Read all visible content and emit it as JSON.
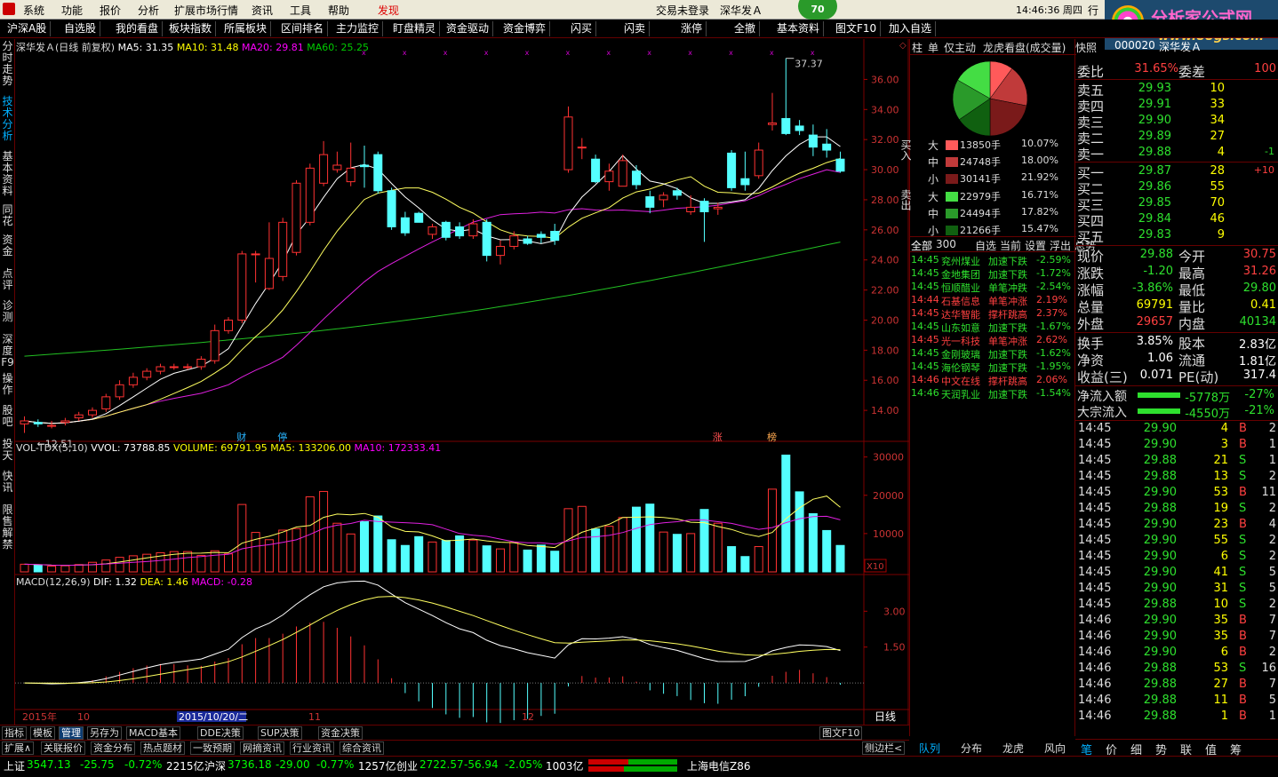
{
  "menu": {
    "items": [
      "系统",
      "功能",
      "报价",
      "分析",
      "扩展市场行情",
      "资讯",
      "工具",
      "帮助",
      "发现"
    ],
    "login": "交易未登录",
    "stock_title": "深华发Ａ",
    "badge": "70",
    "time": "14:46:36 周四",
    "trade": "行"
  },
  "logo": {
    "line1": "分析家公式网",
    "line2": "www.88gs.com"
  },
  "toolbar": [
    "沪深A股",
    "自选股",
    "我的看盘",
    "板块指数",
    "所属板块",
    "区间排名",
    "主力监控",
    "盯盘精灵",
    "资金驱动",
    "资金博弈",
    "闪买",
    "闪卖",
    "涨停",
    "全撤",
    "基本资料",
    "图文F10",
    "加入自选"
  ],
  "left_tabs": [
    "分时走势",
    "技术分析",
    "基本资料",
    "同花",
    "资金",
    "点评",
    "诊测",
    "深度F9",
    "操作",
    "股吧",
    "投天",
    "快讯",
    "限售解禁"
  ],
  "chart": {
    "title": "深华发Ａ(日线 前复权)",
    "ma5": "MA5: 31.35",
    "ma10": "MA10: 31.48",
    "ma20": "MA20: 29.81",
    "ma60": "MA60: 25.25",
    "high_label": "37.37",
    "low_label": "←12.51",
    "price_ticks": [
      "36.00",
      "34.00",
      "32.00",
      "30.00",
      "28.00",
      "26.00",
      "24.00",
      "22.00",
      "20.00",
      "18.00",
      "16.00",
      "14.00"
    ],
    "event_markers": [
      "财",
      "停",
      "涨",
      "榜"
    ],
    "vol_title": "VOL-TDX(5,10)",
    "vvol": "VVOL: 73788.85",
    "volume": "VOLUME: 69791.95",
    "vma5": "MA5: 133206.00",
    "vma10": "MA10: 172333.41",
    "vol_ticks": [
      "30000",
      "20000",
      "10000"
    ],
    "vol_unit": "X10",
    "macd_title": "MACD(12,26,9)",
    "dif": "DIF: 1.32",
    "dea": "DEA: 1.46",
    "macd": "MACD: -0.28",
    "macd_ticks": [
      "3.00",
      "1.50"
    ],
    "dates": [
      "2015年",
      "10",
      "2015/10/20/二",
      "11",
      "12"
    ],
    "period": "日线",
    "zoom_ctrl": [
      "+",
      "-",
      "0"
    ]
  },
  "chart_data": {
    "type": "candlestick",
    "open": [
      13.1,
      13.2,
      13.0,
      13.2,
      13.5,
      13.7,
      14.1,
      14.9,
      15.7,
      16.2,
      16.6,
      16.9,
      16.9,
      16.9,
      17.3,
      19.3,
      20.0,
      24.4,
      22.1,
      22.9,
      24.5,
      26.5,
      29.1,
      30.0,
      29.2,
      30.3,
      31.0,
      28.6,
      26.8,
      27.1,
      25.7,
      26.5,
      26.2,
      25.6,
      26.5,
      24.3,
      24.9,
      25.4,
      25.7,
      25.9,
      30.0,
      31.5,
      30.7,
      29.2,
      28.9,
      29.9,
      28.2,
      28.0,
      28.6,
      27.2,
      27.9,
      27.4,
      31.1,
      29.4,
      29.6,
      33.0,
      33.4,
      32.9,
      32.3,
      31.7,
      30.7
    ],
    "close": [
      13.3,
      13.1,
      13.0,
      13.3,
      13.7,
      14.0,
      14.9,
      15.7,
      16.2,
      16.6,
      16.9,
      16.9,
      16.9,
      17.4,
      19.3,
      20.0,
      24.4,
      24.4,
      24.1,
      26.5,
      29.1,
      30.1,
      31.0,
      30.3,
      30.1,
      30.2,
      28.6,
      26.2,
      25.8,
      26.5,
      26.2,
      25.5,
      25.6,
      26.4,
      24.3,
      24.9,
      25.6,
      25.1,
      25.5,
      25.3,
      33.5,
      31.5,
      29.2,
      29.9,
      30.6,
      29.0,
      27.5,
      28.3,
      28.3,
      27.5,
      27.2,
      27.5,
      28.8,
      29.0,
      31.3,
      33.1,
      32.4,
      32.6,
      31.5,
      31.3,
      29.9
    ],
    "high": [
      13.6,
      13.4,
      13.3,
      13.5,
      13.9,
      14.2,
      15.1,
      16.0,
      16.5,
      16.8,
      17.1,
      17.1,
      17.1,
      17.6,
      19.7,
      20.2,
      24.6,
      24.6,
      26.5,
      26.8,
      29.3,
      30.4,
      31.9,
      31.2,
      31.8,
      31.6,
      31.2,
      28.8,
      27.2,
      27.2,
      26.4,
      26.6,
      26.5,
      26.7,
      26.7,
      25.3,
      25.9,
      25.6,
      25.9,
      26.4,
      34.2,
      32.1,
      31.0,
      30.4,
      31.0,
      30.3,
      28.6,
      28.5,
      28.8,
      28.3,
      28.1,
      27.8,
      31.3,
      31.2,
      31.8,
      35.1,
      37.4,
      33.3,
      33.0,
      32.7,
      31.2
    ],
    "low": [
      12.5,
      12.9,
      12.8,
      13.0,
      13.3,
      13.5,
      13.9,
      14.7,
      15.5,
      16.0,
      16.4,
      16.7,
      16.7,
      16.7,
      17.1,
      19.1,
      19.8,
      22.5,
      22.0,
      22.6,
      24.3,
      26.3,
      28.9,
      29.8,
      28.9,
      28.8,
      28.4,
      26.0,
      25.6,
      26.6,
      25.4,
      25.3,
      25.4,
      25.4,
      23.9,
      23.7,
      24.7,
      25.0,
      25.1,
      25.0,
      29.8,
      30.7,
      29.1,
      28.6,
      28.9,
      28.7,
      27.1,
      27.5,
      28.0,
      27.0,
      25.2,
      27.0,
      28.6,
      28.6,
      29.4,
      32.6,
      32.3,
      32.3,
      30.9,
      30.8,
      29.8
    ],
    "volume": [
      2000,
      1800,
      1500,
      1600,
      1900,
      2500,
      3100,
      3800,
      4200,
      4600,
      5000,
      5300,
      5300,
      4300,
      5500,
      4700,
      17600,
      10300,
      8400,
      10900,
      11300,
      19600,
      21000,
      12700,
      9900,
      13100,
      14600,
      8400,
      6900,
      9200,
      7800,
      8200,
      9400,
      8300,
      6800,
      6000,
      7700,
      5700,
      7000,
      5400,
      16500,
      17100,
      11200,
      11900,
      14200,
      16900,
      17700,
      10400,
      9800,
      10000,
      16300,
      12700,
      6600,
      4000,
      6600,
      21600,
      30500,
      20900,
      15200,
      10800,
      6900
    ],
    "ylim": [
      12.0,
      37.5
    ],
    "macd_ylim": [
      -1.0,
      4.2
    ],
    "x_labels": [
      "2015年",
      "10",
      "11",
      "12"
    ]
  },
  "rpanel": {
    "tabs": [
      "柱",
      "单",
      "仅主动",
      "龙虎看盘(成交量)",
      "快照"
    ],
    "buy_label": "买入",
    "sell_label": "卖出",
    "buy_rows": [
      [
        "大",
        "13850手",
        "10.07%"
      ],
      [
        "中",
        "24748手",
        "18.00%"
      ],
      [
        "小",
        "30141手",
        "21.92%"
      ]
    ],
    "sell_rows": [
      [
        "大",
        "22979手",
        "16.71%"
      ],
      [
        "中",
        "24494手",
        "17.82%"
      ],
      [
        "小",
        "21266手",
        "15.47%"
      ]
    ],
    "pie_pct": [
      10.07,
      18.0,
      21.92,
      16.71,
      17.82,
      15.47
    ],
    "filter_tabs": [
      "全部",
      "300",
      "自选",
      "当前",
      "设置",
      "浮出",
      "总势"
    ],
    "alerts": [
      [
        "14:45",
        "兖州煤业",
        "加速下跌",
        "-2.59%"
      ],
      [
        "14:45",
        "金地集团",
        "加速下跌",
        "-1.72%"
      ],
      [
        "14:45",
        "恒顺醋业",
        "单笔冲跌",
        "-2.54%"
      ],
      [
        "14:44",
        "石基信息",
        "单笔冲涨",
        "2.19%"
      ],
      [
        "14:45",
        "达华智能",
        "撑杆跳高",
        "2.37%"
      ],
      [
        "14:45",
        "山东如意",
        "加速下跌",
        "-1.67%"
      ],
      [
        "14:45",
        "光一科技",
        "单笔冲涨",
        "2.62%"
      ],
      [
        "14:45",
        "金刚玻璃",
        "加速下跌",
        "-1.62%"
      ],
      [
        "14:45",
        "海伦钢琴",
        "加速下跌",
        "-1.95%"
      ],
      [
        "14:46",
        "中文在线",
        "撑杆跳高",
        "2.06%"
      ],
      [
        "14:46",
        "天润乳业",
        "加速下跌",
        "-1.54%"
      ]
    ],
    "bottom_tabs": [
      "队列",
      "分布",
      "龙虎",
      "风向"
    ]
  },
  "quote": {
    "code": "000020",
    "name": "深华发Ａ",
    "wb_label": "委比",
    "wb": "31.65%",
    "wc_label": "委差",
    "wc": "100",
    "asks": [
      [
        "卖五",
        "29.93",
        "10",
        ""
      ],
      [
        "卖四",
        "29.91",
        "33",
        ""
      ],
      [
        "卖三",
        "29.90",
        "34",
        ""
      ],
      [
        "卖二",
        "29.89",
        "27",
        ""
      ],
      [
        "卖一",
        "29.88",
        "4",
        "-1"
      ]
    ],
    "bids": [
      [
        "买一",
        "29.87",
        "28",
        "+10"
      ],
      [
        "买二",
        "29.86",
        "55",
        ""
      ],
      [
        "买三",
        "29.85",
        "70",
        ""
      ],
      [
        "买四",
        "29.84",
        "46",
        ""
      ],
      [
        "买五",
        "29.83",
        "9",
        ""
      ]
    ],
    "stats": [
      [
        "现价",
        "29.88",
        "今开",
        "30.75"
      ],
      [
        "涨跌",
        "-1.20",
        "最高",
        "31.26"
      ],
      [
        "涨幅",
        "-3.86%",
        "最低",
        "29.80"
      ],
      [
        "总量",
        "69791",
        "量比",
        "0.41"
      ],
      [
        "外盘",
        "29657",
        "内盘",
        "40134"
      ]
    ],
    "stats2": [
      [
        "换手",
        "3.85%",
        "股本",
        "2.83亿"
      ],
      [
        "净资",
        "1.06",
        "流通",
        "1.81亿"
      ],
      [
        "收益(三)",
        "0.071",
        "PE(动)",
        "317.4"
      ]
    ],
    "flow": [
      [
        "净流入额",
        "-5778万",
        "-27%"
      ],
      [
        "大宗流入",
        "-4550万",
        "-21%"
      ]
    ],
    "ticks": [
      [
        "14:45",
        "29.90",
        "4",
        "B",
        "2"
      ],
      [
        "14:45",
        "29.90",
        "3",
        "B",
        "1"
      ],
      [
        "14:45",
        "29.88",
        "21",
        "S",
        "1"
      ],
      [
        "14:45",
        "29.88",
        "13",
        "S",
        "2"
      ],
      [
        "14:45",
        "29.90",
        "53",
        "B",
        "11"
      ],
      [
        "14:45",
        "29.88",
        "19",
        "S",
        "2"
      ],
      [
        "14:45",
        "29.90",
        "23",
        "B",
        "4"
      ],
      [
        "14:45",
        "29.90",
        "55",
        "S",
        "2"
      ],
      [
        "14:45",
        "29.90",
        "6",
        "S",
        "2"
      ],
      [
        "14:45",
        "29.90",
        "41",
        "S",
        "5"
      ],
      [
        "14:45",
        "29.90",
        "31",
        "S",
        "5"
      ],
      [
        "14:45",
        "29.88",
        "10",
        "S",
        "2"
      ],
      [
        "14:46",
        "29.90",
        "35",
        "B",
        "7"
      ],
      [
        "14:46",
        "29.90",
        "35",
        "B",
        "7"
      ],
      [
        "14:46",
        "29.90",
        "6",
        "B",
        "2"
      ],
      [
        "14:46",
        "29.88",
        "53",
        "S",
        "16"
      ],
      [
        "14:46",
        "29.88",
        "27",
        "B",
        "7"
      ],
      [
        "14:46",
        "29.88",
        "11",
        "B",
        "5"
      ],
      [
        "14:46",
        "29.88",
        "1",
        "B",
        "1"
      ]
    ],
    "bottom_tabs": [
      "笔",
      "价",
      "细",
      "势",
      "联",
      "值",
      "筹"
    ]
  },
  "bottom": {
    "tabs": [
      "指标",
      "模板",
      "管理",
      "另存为",
      "MACD基本",
      "DDE决策",
      "SUP决策",
      "资金决策"
    ],
    "tabs2": [
      "扩展∧",
      "关联报价",
      "资金分布",
      "热点题材",
      "一致预期",
      "网摘资讯",
      "行业资讯",
      "综合资讯"
    ],
    "right": "图文F10",
    "right2": "侧边栏<"
  },
  "status": {
    "sh_label": "上证",
    "sh": "3547.13",
    "sh_chg": "-25.75",
    "sh_pct": "-0.72%",
    "sh_amt": "2215亿",
    "hs_label": "沪深",
    "hs": "3736.18",
    "hs_chg": "-29.00",
    "hs_pct": "-0.77%",
    "hs_amt": "1257亿",
    "cy_label": "创业",
    "cy": "2722.57",
    "cy_chg": "-56.94",
    "cy_pct": "-2.05%",
    "cy_amt": "1003亿",
    "server": "上海电信Z86"
  }
}
